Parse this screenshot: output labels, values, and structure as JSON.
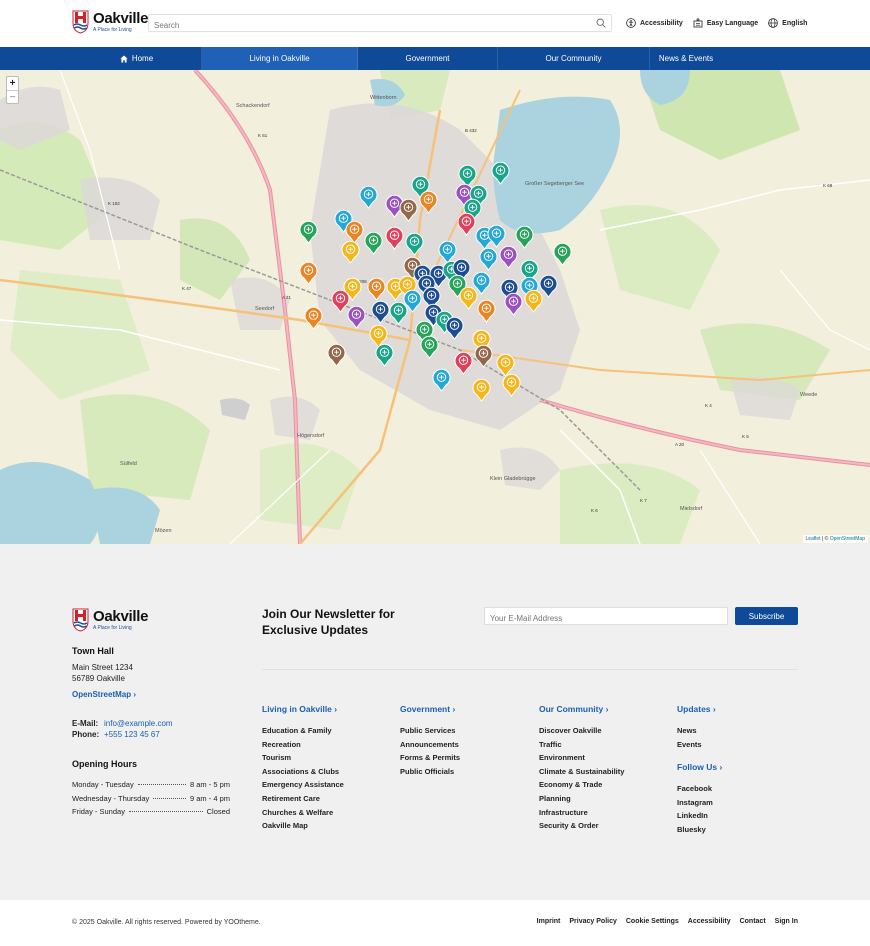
{
  "header": {
    "logo": {
      "name": "Oakville",
      "tagline": "A Place for Living"
    },
    "search": {
      "placeholder": "Search"
    },
    "tools": [
      {
        "label": "Accessibility",
        "icon": "accessibility-icon"
      },
      {
        "label": "Easy Language",
        "icon": "easy-language-icon"
      },
      {
        "label": "English",
        "icon": "globe-icon"
      }
    ]
  },
  "nav": {
    "items": [
      {
        "label": "Home",
        "icon": "home-icon",
        "active": false
      },
      {
        "label": "Living in Oakville",
        "active": true
      },
      {
        "label": "Government",
        "active": false
      },
      {
        "label": "Our Community",
        "active": false
      },
      {
        "label": "News & Events",
        "active": false
      }
    ]
  },
  "map": {
    "zoom_in": "+",
    "zoom_out": "−",
    "attribution": {
      "leaflet": "Leaflet",
      "separator": " | © ",
      "osm": "OpenStreetMap"
    },
    "place_labels": [
      "Großer Segeberger See",
      "Klein Gladebrügge",
      "Högersdorf",
      "Schackendorf",
      "Wittenborn",
      "Weede",
      "Mözen",
      "Mielsdorf",
      "Seedorf",
      "Sülfeld"
    ],
    "road_labels": [
      "K 61",
      "K 102",
      "K 47",
      "A 21",
      "B 206",
      "B 432",
      "A 20",
      "K 4",
      "K 5",
      "K 6",
      "K 7",
      "K 68"
    ],
    "marker_colors": {
      "teal": "#1aa589",
      "green": "#27a35a",
      "orange": "#e98524",
      "yellow": "#f3b71c",
      "red": "#e0405b",
      "purple": "#9b52c0",
      "navy": "#1d4e91",
      "cyan": "#26a8d6",
      "brown": "#93684a"
    }
  },
  "footer": {
    "logo": {
      "name": "Oakville",
      "tagline": "A Place for Living"
    },
    "town_hall": {
      "title": "Town Hall",
      "street": "Main Street 1234",
      "city": "56789 Oakville",
      "map_link": "OpenStreetMap"
    },
    "contact": {
      "email_label": "E-Mail:",
      "email": "info@example.com",
      "phone_label": "Phone:",
      "phone": "+555 123 45 67"
    },
    "hours": {
      "title": "Opening Hours",
      "rows": [
        {
          "days": "Monday - Tuesday",
          "time": "8 am - 5 pm"
        },
        {
          "days": "Wednesday - Thursday",
          "time": "9 am - 4 pm"
        },
        {
          "days": "Friday - Sunday",
          "time": "Closed"
        }
      ]
    },
    "newsletter": {
      "title": "Join Our Newsletter for Exclusive Updates",
      "placeholder": "Your E-Mail Address",
      "button": "Subscribe"
    },
    "columns": [
      {
        "title": "Living in Oakville",
        "items": [
          "Education & Family",
          "Recreation",
          "Tourism",
          "Associations & Clubs",
          "Emergency Assistance",
          "Retirement Care",
          "Churches & Welfare",
          "Oakville Map"
        ]
      },
      {
        "title": "Government",
        "items": [
          "Public Services",
          "Announcements",
          "Forms & Permits",
          "Public Officials"
        ]
      },
      {
        "title": "Our Community",
        "items": [
          "Discover Oakville",
          "Traffic",
          "Environment",
          "Climate & Sustainability",
          "Economy & Trade",
          "Planning",
          "Infrastructure",
          "Security & Order"
        ]
      },
      {
        "title": "Updates",
        "items": [
          "News",
          "Events"
        ]
      }
    ],
    "follow": {
      "title": "Follow Us",
      "items": [
        "Facebook",
        "Instagram",
        "LinkedIn",
        "Bluesky"
      ]
    }
  },
  "bottom": {
    "copyright": "© 2025 Oakville. All rights reserved. Powered by YOOtheme.",
    "links": [
      "Imprint",
      "Privacy Policy",
      "Cookie Settings",
      "Accessibility",
      "Contact",
      "Sign In"
    ]
  }
}
